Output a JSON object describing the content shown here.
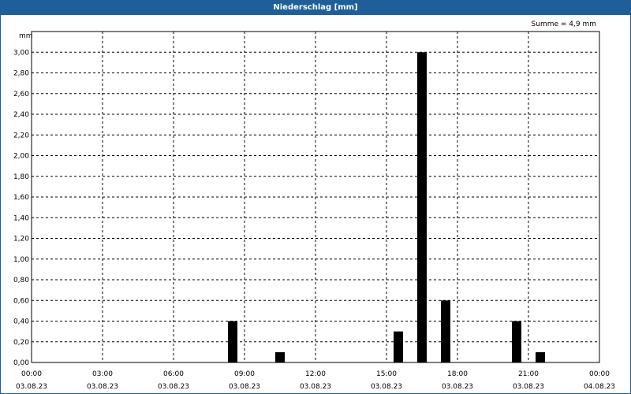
{
  "window": {
    "title": "Niederschlag [mm]"
  },
  "chart_data": {
    "type": "bar",
    "title": "Niederschlag [mm]",
    "ylabel": "mm",
    "annotation": "Summe = 4,9 mm",
    "ylim": [
      0,
      3.2
    ],
    "yticks": [
      0,
      0.2,
      0.4,
      0.6,
      0.8,
      1.0,
      1.2,
      1.4,
      1.6,
      1.8,
      2.0,
      2.2,
      2.4,
      2.6,
      2.8,
      3.0
    ],
    "ytick_labels": [
      "0,00",
      "0,20",
      "0,40",
      "0,60",
      "0,80",
      "1,00",
      "1,20",
      "1,40",
      "1,60",
      "1,80",
      "2,00",
      "2,20",
      "2,40",
      "2,60",
      "2,80",
      "3,00"
    ],
    "x_range_hours": [
      0,
      24
    ],
    "xticks": [
      {
        "hour": 0,
        "time": "00:00",
        "date": "03.08.23"
      },
      {
        "hour": 3,
        "time": "03:00",
        "date": "03.08.23"
      },
      {
        "hour": 6,
        "time": "06:00",
        "date": "03.08.23"
      },
      {
        "hour": 9,
        "time": "09:00",
        "date": "03.08.23"
      },
      {
        "hour": 12,
        "time": "12:00",
        "date": "03.08.23"
      },
      {
        "hour": 15,
        "time": "15:00",
        "date": "03.08.23"
      },
      {
        "hour": 18,
        "time": "18:00",
        "date": "03.08.23"
      },
      {
        "hour": 21,
        "time": "21:00",
        "date": "03.08.23"
      },
      {
        "hour": 24,
        "time": "00:00",
        "date": "04.08.23"
      }
    ],
    "bars": [
      {
        "x_start": "08:00",
        "x_end": "09:00",
        "value": 0.4
      },
      {
        "x_start": "10:00",
        "x_end": "11:00",
        "value": 0.1
      },
      {
        "x_start": "15:00",
        "x_end": "16:00",
        "value": 0.3
      },
      {
        "x_start": "16:00",
        "x_end": "17:00",
        "value": 3.0
      },
      {
        "x_start": "17:00",
        "x_end": "18:00",
        "value": 0.6
      },
      {
        "x_start": "20:00",
        "x_end": "21:00",
        "value": 0.4
      },
      {
        "x_start": "21:00",
        "x_end": "22:00",
        "value": 0.1
      }
    ],
    "colors": {
      "bar": "#000000",
      "grid": "#000000",
      "titlebar": "#1f5f99"
    },
    "grid": true
  }
}
